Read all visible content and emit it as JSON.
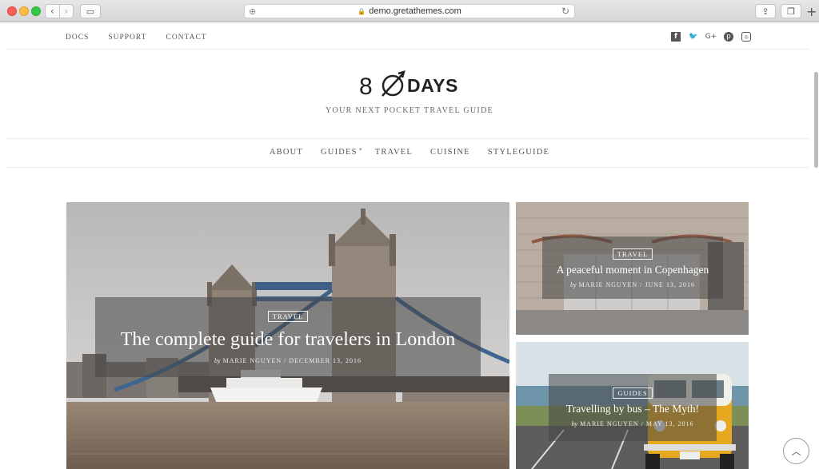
{
  "browser": {
    "url": "demo.gretathemes.com"
  },
  "topnav": [
    {
      "label": "DOCS"
    },
    {
      "label": "SUPPORT"
    },
    {
      "label": "CONTACT"
    }
  ],
  "social_icons": [
    "facebook-icon",
    "twitter-icon",
    "google-plus-icon",
    "pinterest-icon",
    "instagram-icon"
  ],
  "site": {
    "logo_number": "8",
    "logo_word": "DAYS",
    "tagline": "YOUR NEXT POCKET TRAVEL GUIDE"
  },
  "mainnav": [
    {
      "label": "ABOUT"
    },
    {
      "label": "GUIDES"
    },
    {
      "label": "TRAVEL"
    },
    {
      "label": "CUISINE"
    },
    {
      "label": "STYLEGUIDE"
    }
  ],
  "posts": [
    {
      "category": "TRAVEL",
      "title": "The complete guide for travelers in London",
      "by": "by",
      "author": "MARIE NGUYEN",
      "date": "DECEMBER 13, 2016"
    },
    {
      "category": "TRAVEL",
      "title": "A peaceful moment in Copenhagen",
      "by": "by",
      "author": "MARIE NGUYEN",
      "date": "JUNE 13, 2016"
    },
    {
      "category": "GUIDES",
      "title": "Travelling by bus – The Myth!",
      "by": "by",
      "author": "MARIE NGUYEN",
      "date": "MAY 13, 2016"
    }
  ],
  "colors": {
    "text": "#555555",
    "caption_overlay": "#464646",
    "bus_yellow": "#e5a81f"
  }
}
